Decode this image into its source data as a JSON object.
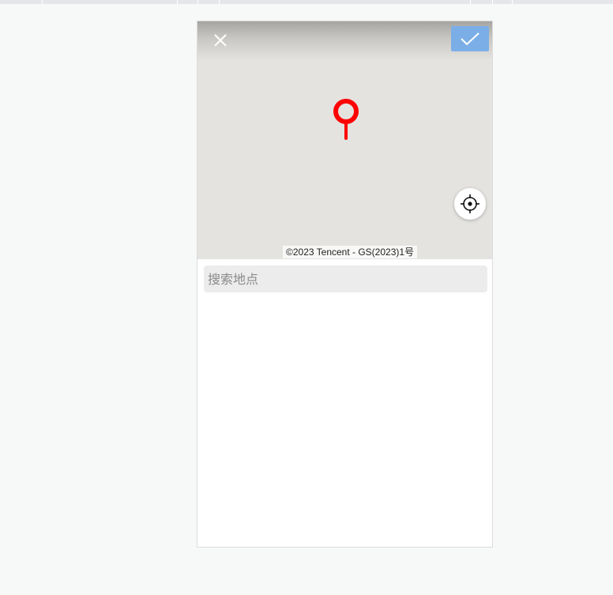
{
  "map": {
    "copyright": "©2023 Tencent - GS(2023)1号"
  },
  "search": {
    "placeholder": "搜索地点",
    "value": ""
  },
  "icons": {
    "close": "close-icon",
    "confirm": "check-icon",
    "pin": "map-pin-icon",
    "locate": "crosshair-icon"
  },
  "colors": {
    "confirm_button": "#7baee6",
    "pin": "#ff0000",
    "map_background": "#e4e3e0",
    "search_background": "#ececec"
  }
}
